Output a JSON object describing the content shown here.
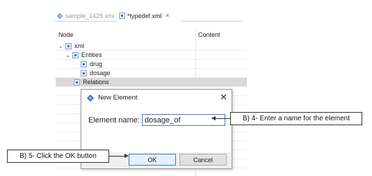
{
  "tabs": [
    {
      "label": "sample_1425.xmi",
      "icon": "xmi-file-icon",
      "active": false
    },
    {
      "label": "*typedef.xml",
      "icon": "xml-file-icon",
      "active": true,
      "close_glyph": "✕"
    }
  ],
  "tree": {
    "columns": [
      "Node",
      "Content"
    ],
    "rows": [
      {
        "label": "xml",
        "expanded": true,
        "icon": "element-icon"
      },
      {
        "label": "Entities",
        "expanded": true,
        "icon": "element-icon"
      },
      {
        "label": "drug",
        "icon": "element-icon"
      },
      {
        "label": "dosage",
        "icon": "element-icon"
      },
      {
        "label": "Relations",
        "icon": "element-icon",
        "selected": true
      }
    ]
  },
  "dialog": {
    "title": "New Element",
    "icon": "eclipse-icon",
    "field_label": "Element name:",
    "field_value": "dosage_of",
    "ok_label": "OK",
    "cancel_label": "Cancel",
    "close_glyph": "✕"
  },
  "annotations": {
    "name_callout": "B) 4- Enter a name for the element",
    "ok_callout": "B) 5- Click the OK button"
  },
  "colors": {
    "accent": "#3a7bd5",
    "selection": "#d9d9d9",
    "dialog_bg": "#f0f0f0"
  }
}
